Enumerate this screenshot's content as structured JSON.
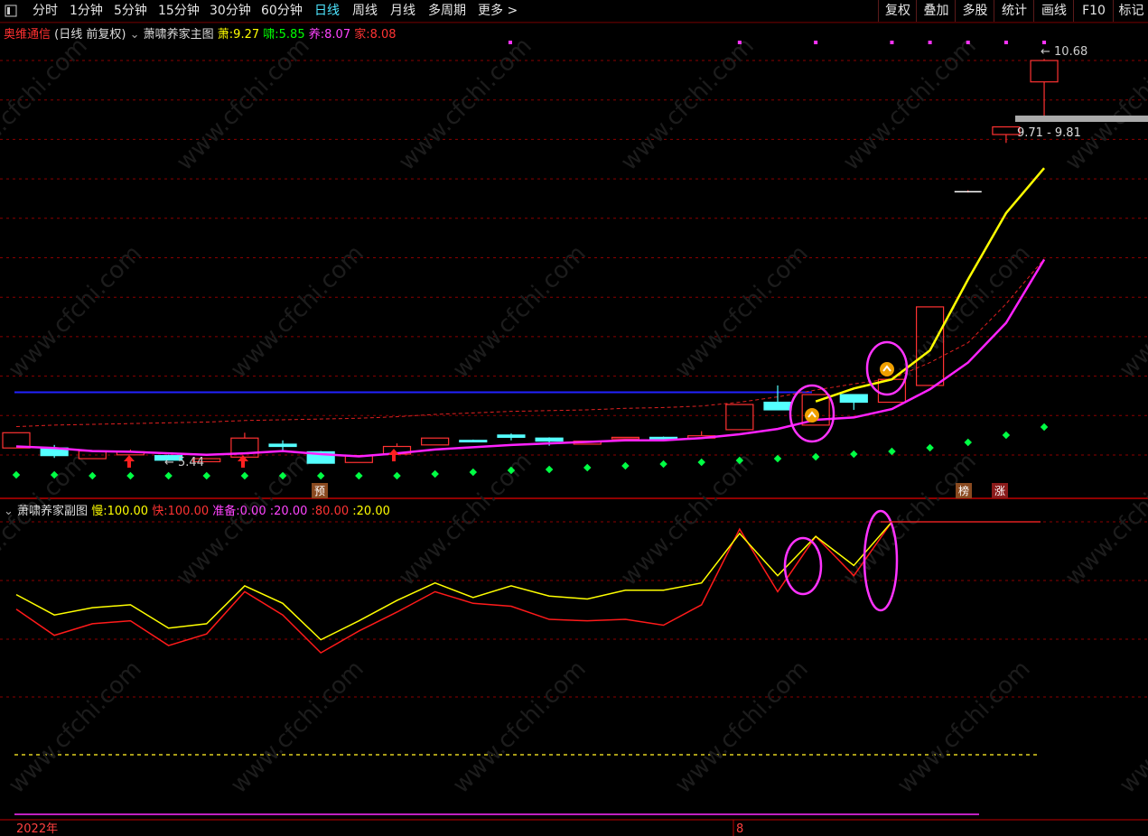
{
  "toolbar": {
    "periods": [
      "分时",
      "1分钟",
      "5分钟",
      "15分钟",
      "30分钟",
      "60分钟",
      "日线",
      "周线",
      "月线",
      "多周期",
      "更多 >"
    ],
    "active_period": "日线",
    "right_buttons": [
      "复权",
      "叠加",
      "多股",
      "统计",
      "画线",
      "F10",
      "标记"
    ]
  },
  "main_header": {
    "stock_name": "奥维通信",
    "mode": "(日线 前复权)",
    "indicator_name": "萧啸养家主图",
    "values": [
      {
        "label": "萧:",
        "value": "9.27",
        "color": "#ffff00"
      },
      {
        "label": "啸:",
        "value": "5.85",
        "color": "#00ff00"
      },
      {
        "label": "养:",
        "value": "8.07",
        "color": "#ff44ff"
      },
      {
        "label": "家:",
        "value": "8.08",
        "color": "#ff3333"
      }
    ]
  },
  "sub_header": {
    "indicator_name": "萧啸养家副图",
    "values": [
      {
        "label": "慢:",
        "value": "100.00",
        "color": "#ffff00"
      },
      {
        "label": "快:",
        "value": "100.00",
        "color": "#ff3333"
      },
      {
        "label": "准备:",
        "value": "0.00",
        "color": "#ff44ff"
      },
      {
        "label": ":",
        "value": "20.00",
        "color": "#ff44ff"
      },
      {
        "label": ":",
        "value": "80.00",
        "color": "#ff3333"
      },
      {
        "label": ":",
        "value": "20.00",
        "color": "#ffff00"
      }
    ]
  },
  "annotations": {
    "high_label": "10.68",
    "low_label": "5.44",
    "range_label": "9.71 - 9.81",
    "marker_yu": "预",
    "marker_bang": "榜",
    "marker_zhang": "涨"
  },
  "time_axis": {
    "year_label": "2022年",
    "month_label": "8"
  },
  "colors": {
    "background": "#000000",
    "grid": "#8b0000",
    "up_candle": "#ff3232",
    "down_candle": "#54ffff",
    "slow_line": "#ffff00",
    "fast_line": "#ff1a1a",
    "ma_line": "#ff22ff",
    "blue_line": "#2222ff",
    "green_dots": "#00ff44",
    "active_tab": "#4ee5ff"
  },
  "chart_data": {
    "type": "candlestick",
    "candles": [
      {
        "o": 5.6,
        "c": 5.8,
        "h": 5.8,
        "l": 5.6
      },
      {
        "o": 5.6,
        "c": 5.5,
        "h": 5.64,
        "l": 5.47
      },
      {
        "o": 5.46,
        "c": 5.56,
        "h": 5.56,
        "l": 5.46
      },
      {
        "o": 5.51,
        "c": 5.55,
        "h": 5.58,
        "l": 5.51
      },
      {
        "o": 5.5,
        "c": 5.44,
        "h": 5.51,
        "l": 5.44
      },
      {
        "o": 5.42,
        "c": 5.46,
        "h": 5.46,
        "l": 5.42
      },
      {
        "o": 5.48,
        "c": 5.73,
        "h": 5.8,
        "l": 5.47
      },
      {
        "o": 5.65,
        "c": 5.62,
        "h": 5.7,
        "l": 5.55
      },
      {
        "o": 5.55,
        "c": 5.4,
        "h": 5.56,
        "l": 5.4
      },
      {
        "o": 5.41,
        "c": 5.5,
        "h": 5.5,
        "l": 5.41
      },
      {
        "o": 5.52,
        "c": 5.62,
        "h": 5.66,
        "l": 5.52
      },
      {
        "o": 5.64,
        "c": 5.73,
        "h": 5.73,
        "l": 5.64
      },
      {
        "o": 5.7,
        "c": 5.68,
        "h": 5.71,
        "l": 5.68
      },
      {
        "o": 5.77,
        "c": 5.74,
        "h": 5.79,
        "l": 5.7
      },
      {
        "o": 5.73,
        "c": 5.69,
        "h": 5.74,
        "l": 5.63
      },
      {
        "o": 5.65,
        "c": 5.69,
        "h": 5.69,
        "l": 5.65
      },
      {
        "o": 5.72,
        "c": 5.74,
        "h": 5.74,
        "l": 5.72
      },
      {
        "o": 5.74,
        "c": 5.73,
        "h": 5.75,
        "l": 5.71
      },
      {
        "o": 5.73,
        "c": 5.76,
        "h": 5.82,
        "l": 5.73
      },
      {
        "o": 5.84,
        "c": 6.17,
        "h": 6.17,
        "l": 5.84
      },
      {
        "o": 6.2,
        "c": 6.1,
        "h": 6.42,
        "l": 6.1
      },
      {
        "o": 5.9,
        "c": 6.3,
        "h": 6.3,
        "l": 5.9
      },
      {
        "o": 6.3,
        "c": 6.2,
        "h": 6.3,
        "l": 6.1
      },
      {
        "o": 6.2,
        "c": 6.5,
        "h": 6.5,
        "l": 6.2
      },
      {
        "o": 6.42,
        "c": 7.45,
        "h": 7.45,
        "l": 6.42
      },
      {
        "o": 8.96,
        "c": 8.96,
        "h": 8.98,
        "l": 8.94
      },
      {
        "o": 9.71,
        "c": 9.81,
        "h": 9.81,
        "l": 9.6
      },
      {
        "o": 10.4,
        "c": 10.68,
        "h": 10.7,
        "l": 9.9
      }
    ],
    "yellow_line": [
      null,
      null,
      null,
      null,
      null,
      null,
      null,
      null,
      null,
      null,
      null,
      null,
      null,
      null,
      null,
      null,
      null,
      null,
      null,
      null,
      null,
      6.21,
      6.38,
      6.5,
      6.88,
      7.81,
      8.68,
      9.27
    ],
    "ma_line": [
      5.62,
      5.6,
      5.56,
      5.55,
      5.53,
      5.51,
      5.53,
      5.56,
      5.52,
      5.49,
      5.53,
      5.58,
      5.61,
      5.64,
      5.66,
      5.68,
      5.7,
      5.7,
      5.73,
      5.78,
      5.85,
      5.97,
      6.0,
      6.11,
      6.37,
      6.72,
      7.24,
      8.07
    ],
    "red_dashed": [
      5.88,
      5.9,
      5.91,
      5.92,
      5.93,
      5.94,
      5.96,
      5.97,
      5.98,
      5.99,
      6.01,
      6.04,
      6.06,
      6.08,
      6.09,
      6.1,
      6.12,
      6.13,
      6.15,
      6.2,
      6.27,
      6.36,
      6.44,
      6.51,
      6.72,
      6.98,
      7.49,
      8.08
    ],
    "blue_line_value": 6.33,
    "slow": [
      75.0,
      68.0,
      70.5,
      71.5,
      63.5,
      65.0,
      78.0,
      72.0,
      59.5,
      66.0,
      73.0,
      79.0,
      74.0,
      78.0,
      74.5,
      73.5,
      76.5,
      76.5,
      79.0,
      96.0,
      81.5,
      95.0,
      85.0,
      100.0,
      null,
      null,
      null,
      null
    ],
    "fast": [
      70.0,
      61.0,
      65.0,
      66.0,
      57.5,
      61.5,
      76.0,
      68.0,
      55.0,
      62.5,
      69.0,
      76.0,
      72.0,
      71.0,
      66.5,
      66.0,
      66.5,
      64.5,
      71.5,
      97.5,
      76.0,
      95.0,
      81.5,
      100.0,
      null,
      null,
      null,
      null
    ],
    "levels": {
      "high": 100.0,
      "upper": 80.0,
      "lower": 20.0
    }
  }
}
